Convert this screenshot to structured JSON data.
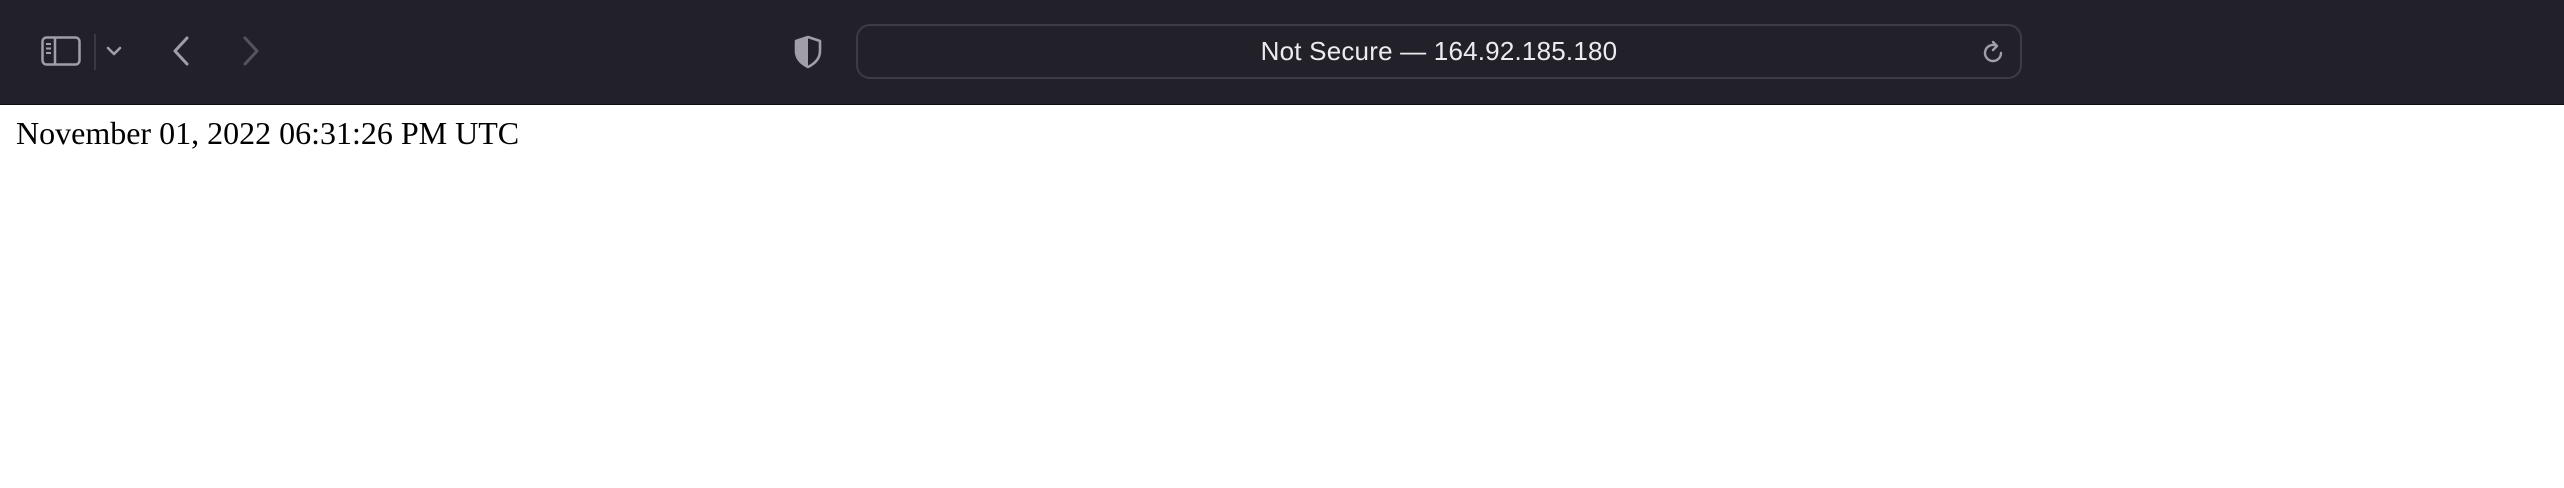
{
  "browser": {
    "address_bar": {
      "security_label": "Not Secure",
      "separator": "—",
      "host": "164.92.185.180",
      "display_text": "Not Secure — 164.92.185.180"
    },
    "icons": {
      "sidebar": "sidebar-icon",
      "sidebar_menu": "chevron-down-icon",
      "back": "chevron-left-icon",
      "forward": "chevron-right-icon",
      "privacy": "shield-icon",
      "reload": "reload-icon"
    },
    "colors": {
      "toolbar_bg": "#222029",
      "icon_active": "#a09ea7",
      "icon_disabled": "#55535c",
      "address_text": "#ececf0"
    }
  },
  "page": {
    "timestamp": "November 01, 2022 06:31:26 PM UTC"
  }
}
